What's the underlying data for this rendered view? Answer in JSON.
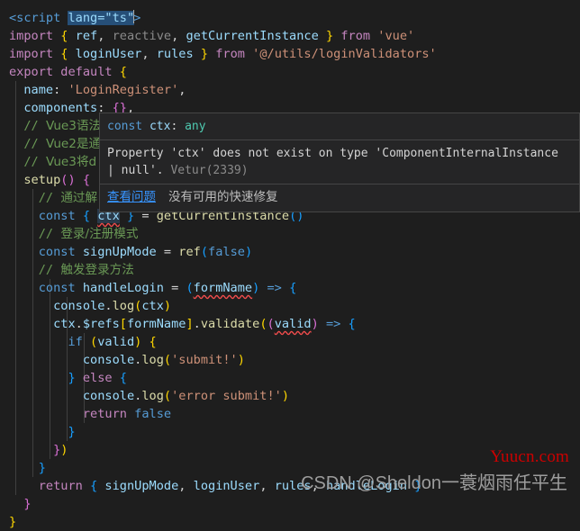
{
  "editor": {
    "background": "#1e1e1e",
    "foreground": "#d4d4d4",
    "lines": [
      "<script lang=\"ts\">",
      "import { ref, reactive, getCurrentInstance } from 'vue'",
      "import { loginUser, rules } from '@/utils/loginValidators'",
      "export default {",
      "  name: 'LoginRegister',",
      "  components: {},",
      "  // Vue3语法",
      "  // Vue2是通",
      "  // Vue3将d",
      "  setup() {",
      "    // 通过解",
      "    const { ctx } = getCurrentInstance()",
      "    // 登录/注册模式",
      "    const signUpMode = ref(false)",
      "    // 触发登录方法",
      "    const handleLogin = (formName) => {",
      "      console.log(ctx)",
      "      ctx.$refs[formName].validate((valid) => {",
      "        if (valid) {",
      "          console.log('submit!')",
      "        } else {",
      "          console.log('error submit!')",
      "          return false",
      "        }",
      "      })",
      "    }",
      "    return { signUpMode, loginUser, rules, handleLogin }",
      "  }",
      "}"
    ],
    "selection": {
      "text": "lang=\"ts\"",
      "line": 1
    },
    "errors": [
      {
        "token": "ctx",
        "line": 12
      },
      {
        "token": "formName",
        "line": 16
      },
      {
        "token": "valid",
        "line": 18
      }
    ]
  },
  "hover_tooltip": {
    "signature": {
      "keyword": "const",
      "name": "ctx",
      "separator": ":",
      "type": "any"
    },
    "message": "Property 'ctx' does not exist on type 'ComponentInternalInstance | null'.",
    "source": "Vetur(2339)",
    "actions": {
      "view_problem": "查看问题",
      "no_quick_fix": "没有可用的快速修复"
    }
  },
  "watermarks": {
    "site": "Yuucn.com",
    "author": "CSDN @Sheldon一蓑烟雨任平生"
  }
}
